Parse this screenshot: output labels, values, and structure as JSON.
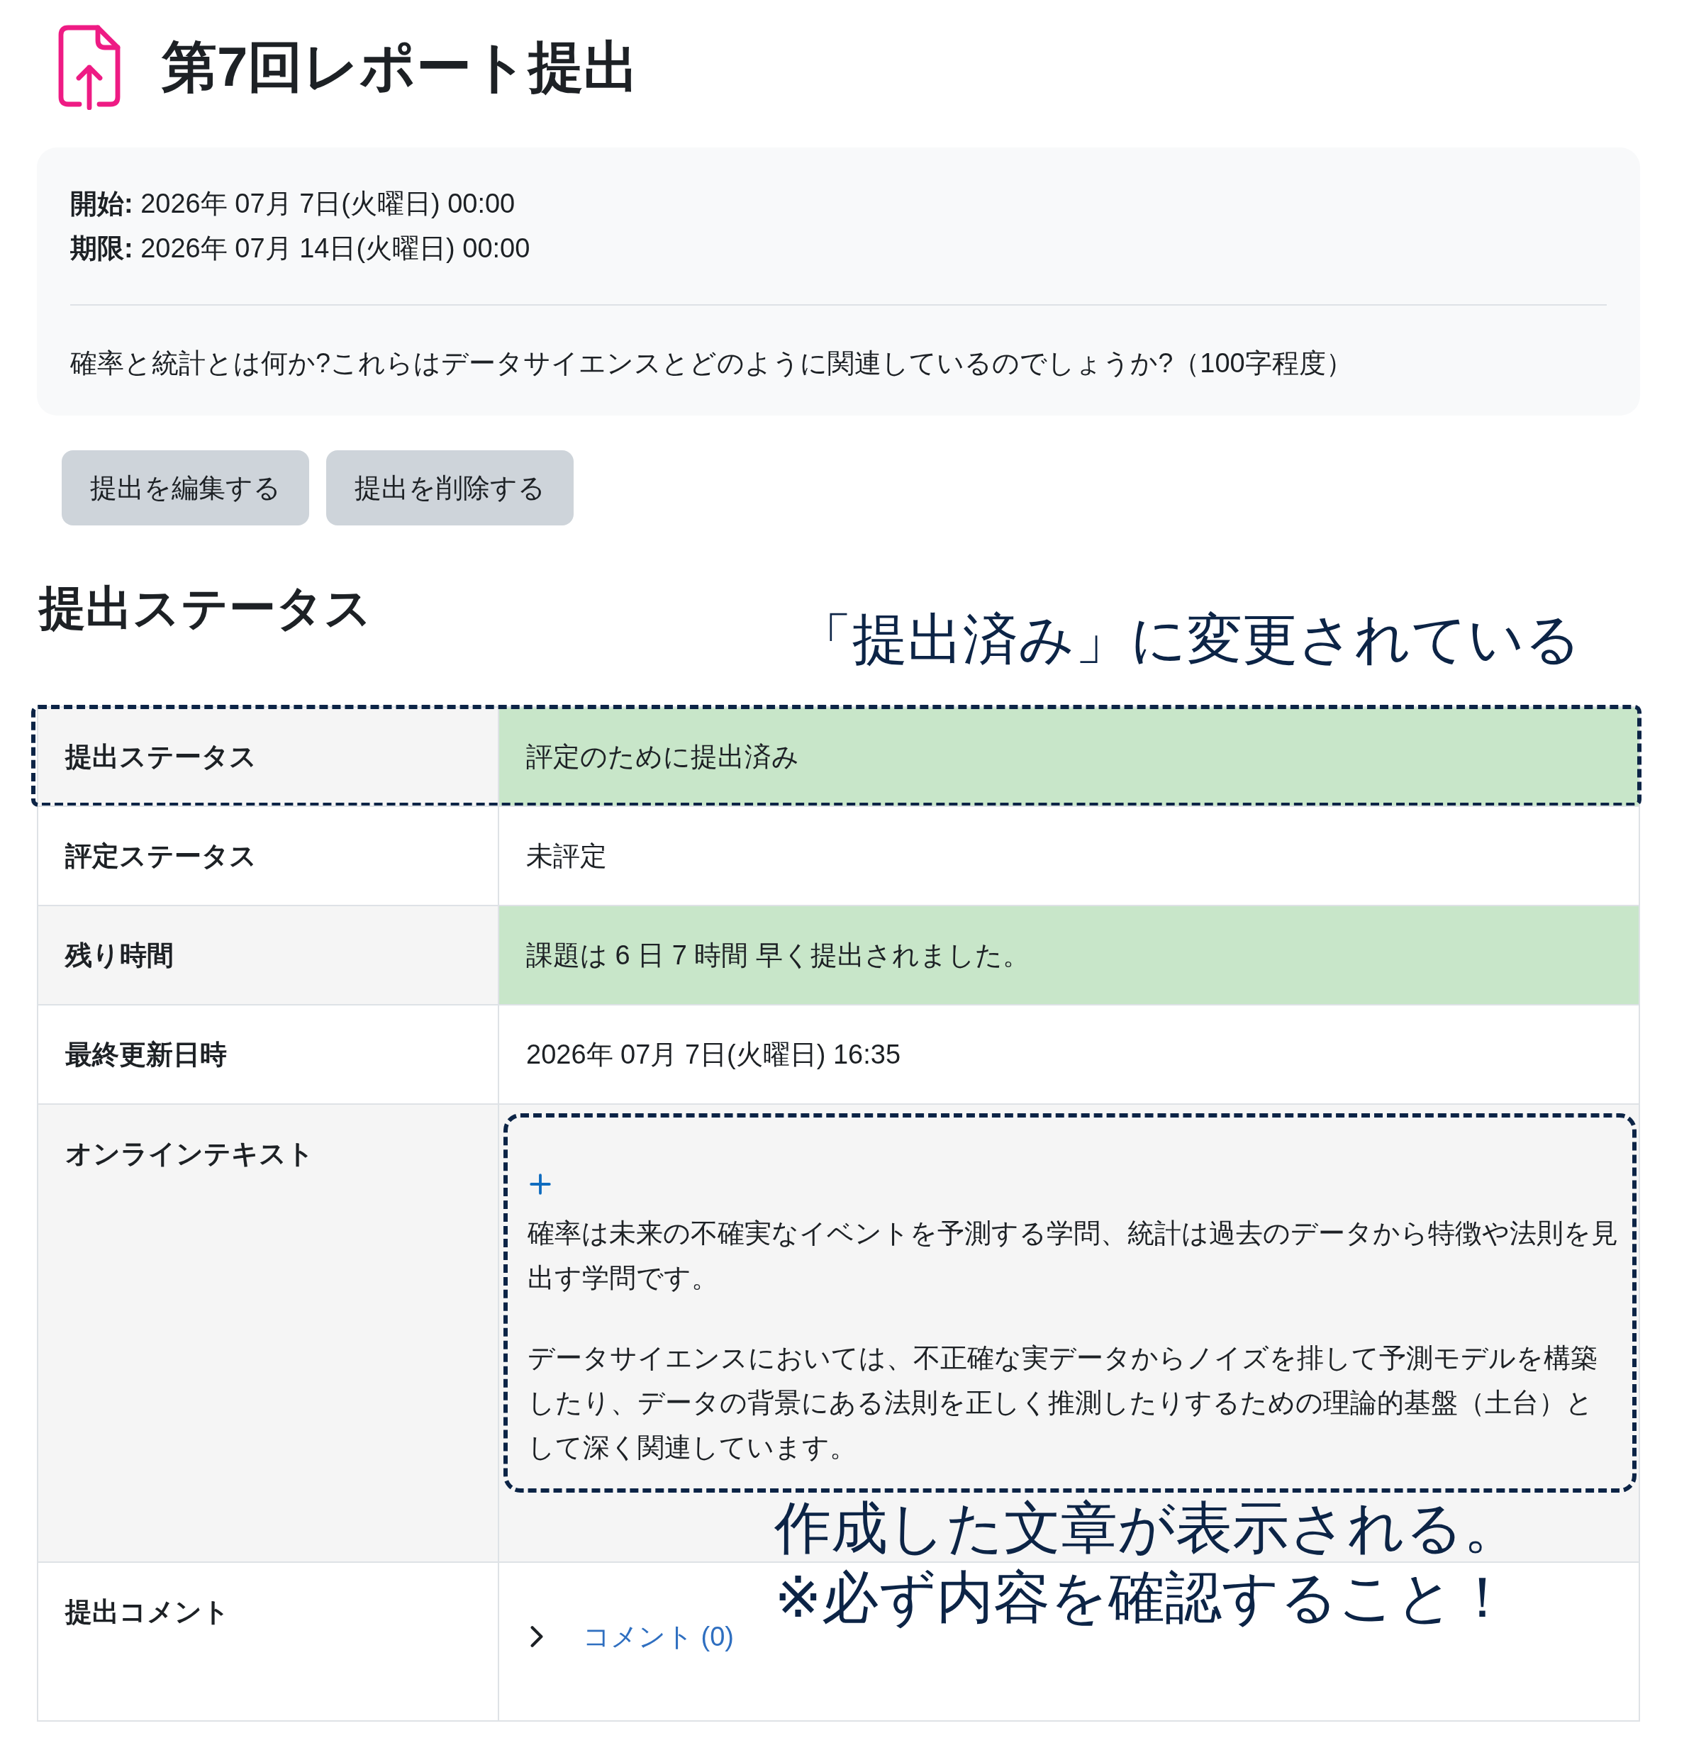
{
  "header": {
    "title": "第7回レポート提出"
  },
  "dates": [
    {
      "label": "開始:",
      "value": "2026年 07月 7日(火曜日) 00:00"
    },
    {
      "label": "期限:",
      "value": "2026年 07月 14日(火曜日) 00:00"
    }
  ],
  "description": "確率と統計とは何か?これらはデータサイエンスとどのように関連しているのでしょうか?（100字程度）",
  "buttons": [
    "提出を編集する",
    "提出を削除する"
  ],
  "submission_status": {
    "heading": "提出ステータス",
    "rows": [
      {
        "label": "提出ステータス",
        "kind": "text",
        "value": "評定のために提出済み",
        "success": true,
        "outlined": true
      },
      {
        "label": "評定ステータス",
        "kind": "text",
        "value": "未評定",
        "success": false,
        "outlined": false
      },
      {
        "label": "残り時間",
        "kind": "text",
        "value": "課題は 6 日 7 時間 早く提出されました。",
        "success": true,
        "outlined": false
      },
      {
        "label": "最終更新日時",
        "kind": "text",
        "value": "2026年 07月 7日(火曜日) 16:35",
        "success": false,
        "outlined": false
      },
      {
        "label": "オンラインテキスト",
        "kind": "online_text",
        "expanded": false,
        "text_outlined": true,
        "paragraphs": [
          "確率は未来の不確実なイベントを予測する学問、統計は過去のデータから特徴や法則を見出す学問です。",
          "データサイエンスにおいては、不正確な実データからノイズを排して予測モデルを構築したり、データの背景にある法則を正しく推測したりするための理論的基盤（土台）として深く関連しています。"
        ],
        "success": false,
        "outlined": false
      },
      {
        "label": "提出コメント",
        "kind": "comments",
        "expanded": false,
        "link": "コメント (0)",
        "success": false,
        "outlined": false
      }
    ]
  },
  "annotations": [
    {
      "lines": [
        "「提出済み」に変更されている"
      ]
    },
    {
      "lines": [
        "作成した文章が表示される。",
        "※必ず内容を確認すること！"
      ]
    }
  ]
}
